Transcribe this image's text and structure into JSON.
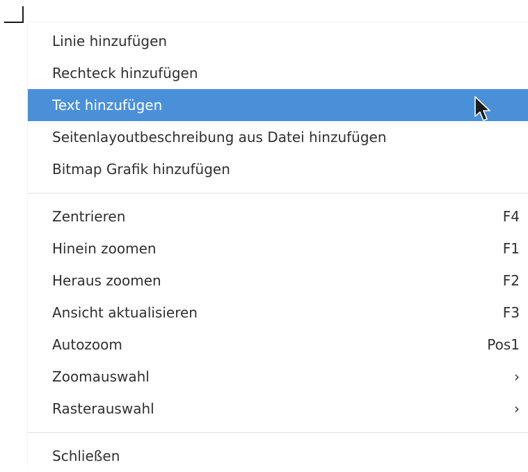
{
  "context_menu": {
    "groups": [
      [
        {
          "label": "Linie hinzufügen",
          "shortcut": "",
          "submenu": false,
          "selected": false
        },
        {
          "label": "Rechteck hinzufügen",
          "shortcut": "",
          "submenu": false,
          "selected": false
        },
        {
          "label": "Text hinzufügen",
          "shortcut": "",
          "submenu": false,
          "selected": true
        },
        {
          "label": "Seitenlayoutbeschreibung aus Datei hinzufügen",
          "shortcut": "",
          "submenu": false,
          "selected": false
        },
        {
          "label": "Bitmap Grafik hinzufügen",
          "shortcut": "",
          "submenu": false,
          "selected": false
        }
      ],
      [
        {
          "label": "Zentrieren",
          "shortcut": "F4",
          "submenu": false,
          "selected": false
        },
        {
          "label": "Hinein zoomen",
          "shortcut": "F1",
          "submenu": false,
          "selected": false
        },
        {
          "label": "Heraus zoomen",
          "shortcut": "F2",
          "submenu": false,
          "selected": false
        },
        {
          "label": "Ansicht aktualisieren",
          "shortcut": "F3",
          "submenu": false,
          "selected": false
        },
        {
          "label": "Autozoom",
          "shortcut": "Pos1",
          "submenu": false,
          "selected": false
        },
        {
          "label": "Zoomauswahl",
          "shortcut": "",
          "submenu": true,
          "selected": false
        },
        {
          "label": "Rasterauswahl",
          "shortcut": "",
          "submenu": true,
          "selected": false
        }
      ],
      [
        {
          "label": "Schließen",
          "shortcut": "",
          "submenu": false,
          "selected": false
        }
      ]
    ],
    "submenu_glyph": "›",
    "highlight_color": "#4a90d9",
    "text_color": "#2f2f2f"
  },
  "icons": {
    "cursor": "arrow-pointer-icon",
    "corner": "canvas-corner-mark"
  }
}
